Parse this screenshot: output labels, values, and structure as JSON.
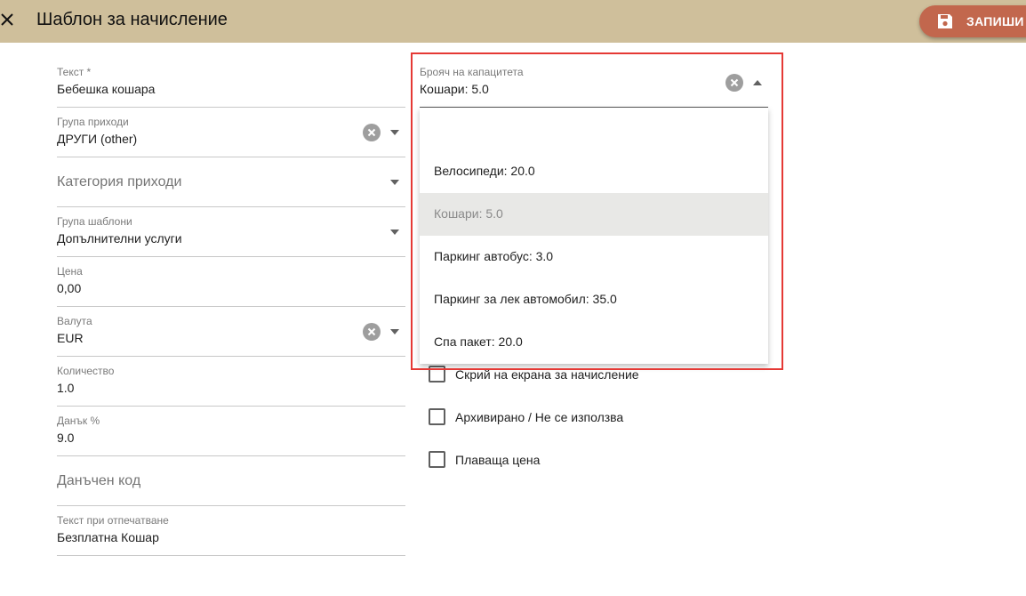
{
  "header": {
    "title": "Шаблон за начисление",
    "save_label": "ЗАПИШИ",
    "close_icon": "close-icon",
    "save_icon": "floppy-disk-icon",
    "background_color": "#cfbf9b",
    "save_button_color": "#c2674d"
  },
  "form": {
    "text": {
      "label": "Текст *",
      "value": "Бебешка кошара"
    },
    "income_group": {
      "label": "Група приходи",
      "value": "ДРУГИ (other)"
    },
    "income_category": {
      "placeholder": "Категория приходи"
    },
    "template_group": {
      "label": "Група шаблони",
      "value": "Допълнителни услуги"
    },
    "price": {
      "label": "Цена",
      "value": "0,00"
    },
    "currency": {
      "label": "Валута",
      "value": "EUR"
    },
    "quantity": {
      "label": "Количество",
      "value": "1.0"
    },
    "tax": {
      "label": "Данък %",
      "value": "9.0"
    },
    "tax_code": {
      "placeholder": "Данъчен код"
    },
    "print_text": {
      "label": "Текст при отпечатване",
      "value": "Безплатна Кошар"
    }
  },
  "capacity_counter": {
    "label": "Брояч на капацитета",
    "value": "Кошари: 5.0",
    "options": [
      "",
      "Велосипеди: 20.0",
      "Кошари: 5.0",
      "Паркинг автобус: 3.0",
      "Паркинг за лек автомобил: 35.0",
      "Спа пакет: 20.0"
    ],
    "selected_index": 2,
    "highlight_color": "#e53935"
  },
  "checkboxes": [
    {
      "label": "Скрий на екрана за начисление",
      "checked": false
    },
    {
      "label": "Архивирано / Не се използва",
      "checked": false
    },
    {
      "label": "Плаваща цена",
      "checked": false
    }
  ]
}
